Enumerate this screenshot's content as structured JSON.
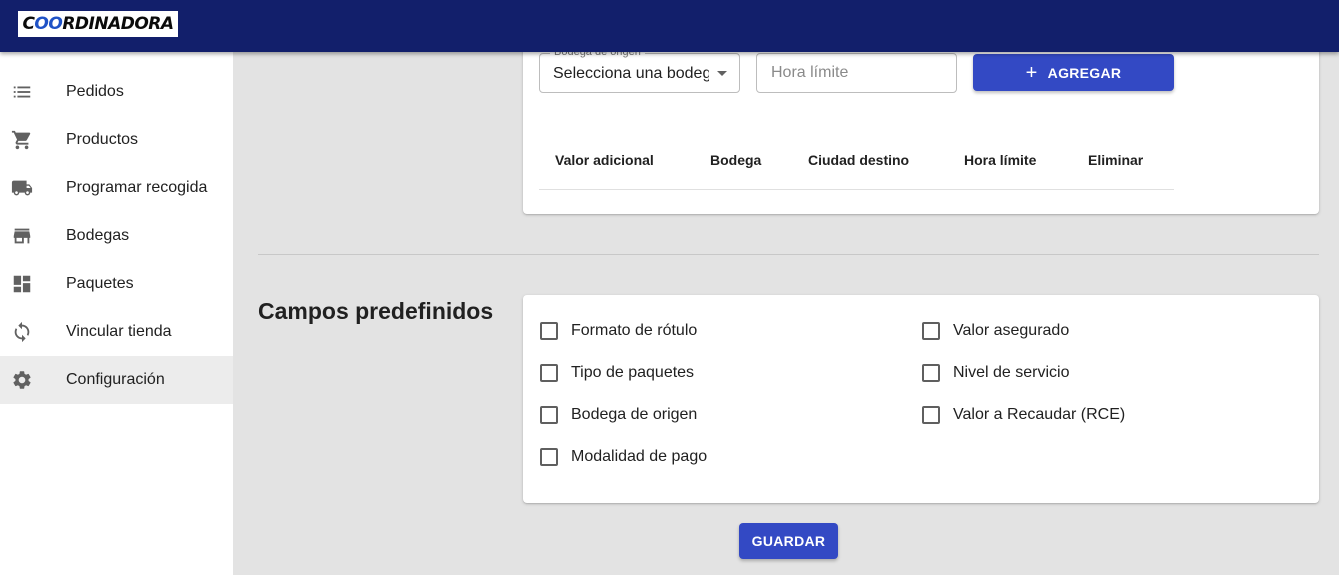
{
  "header": {
    "logo_text": "COORDINADORA"
  },
  "sidebar": {
    "items": [
      {
        "label": "Pedidos",
        "icon": "list-icon"
      },
      {
        "label": "Productos",
        "icon": "shopping-cart-icon"
      },
      {
        "label": "Programar recogida",
        "icon": "truck-icon"
      },
      {
        "label": "Bodegas",
        "icon": "store-icon"
      },
      {
        "label": "Paquetes",
        "icon": "dashboard-icon"
      },
      {
        "label": "Vincular tienda",
        "icon": "sync-icon"
      },
      {
        "label": "Configuración",
        "icon": "gear-icon",
        "active": true
      }
    ]
  },
  "form": {
    "warehouse_select": {
      "label": "Bodega de origen",
      "value": "Selecciona una bodega"
    },
    "time_input": {
      "placeholder": "Hora límite",
      "value": ""
    },
    "add_button": "AGREGAR",
    "table_headers": [
      "Valor adicional",
      "Bodega",
      "Ciudad destino",
      "Hora límite",
      "Eliminar"
    ]
  },
  "predefined": {
    "title": "Campos predefinidos",
    "left_options": [
      {
        "label": "Formato de rótulo",
        "checked": false
      },
      {
        "label": "Tipo de paquetes",
        "checked": false
      },
      {
        "label": "Bodega de origen",
        "checked": false
      },
      {
        "label": "Modalidad de pago",
        "checked": false
      }
    ],
    "right_options": [
      {
        "label": "Valor asegurado",
        "checked": false
      },
      {
        "label": "Nivel de servicio",
        "checked": false
      },
      {
        "label": "Valor a Recaudar (RCE)",
        "checked": false
      }
    ]
  },
  "save_button": "GUARDAR",
  "colors": {
    "topbar": "#121f6b",
    "primary_button": "#3349c4",
    "background": "#e3e3e3",
    "active_nav": "#ececec"
  }
}
